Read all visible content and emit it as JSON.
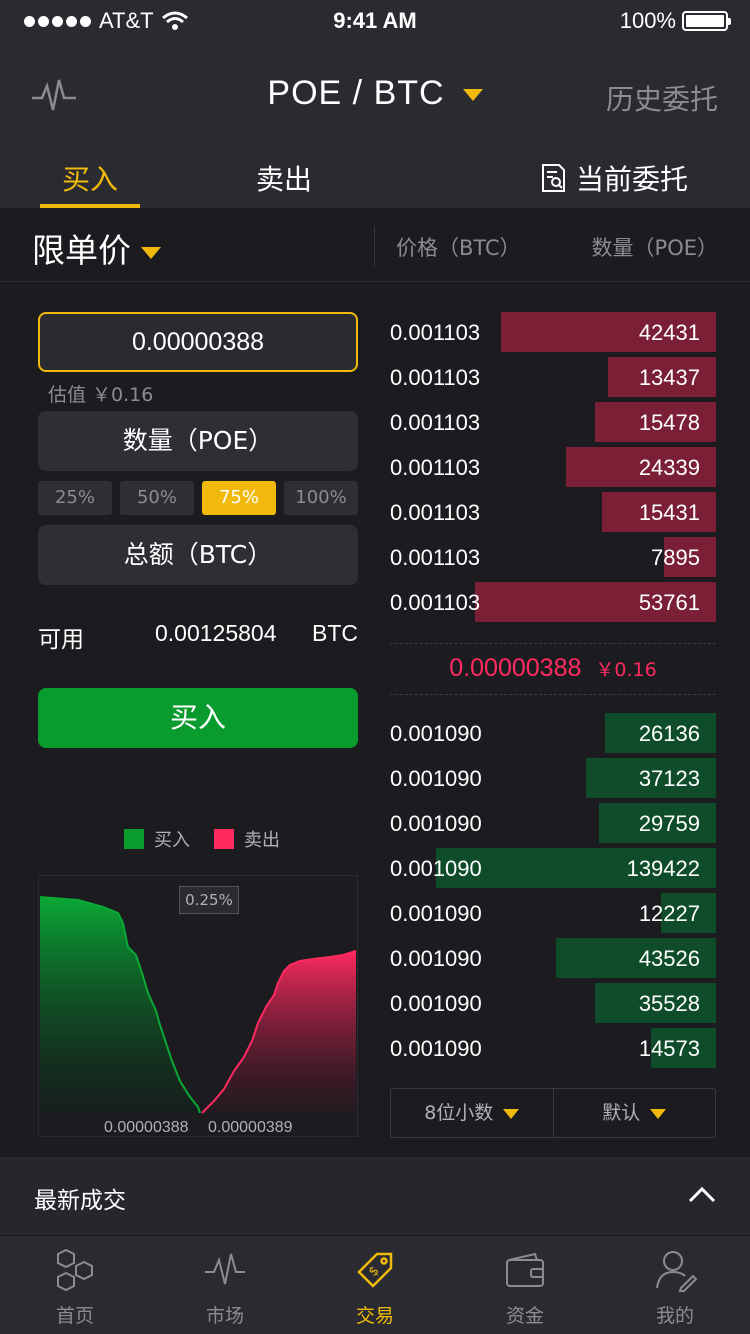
{
  "status": {
    "carrier": "AT&T",
    "time": "9:41 AM",
    "battery": "100%"
  },
  "header": {
    "pair": "POE / BTC",
    "history": "历史委托"
  },
  "tabs": {
    "buy": "买入",
    "sell": "卖出",
    "orders": "当前委托"
  },
  "order_type": {
    "label": "限单价",
    "price_header": "价格（BTC）",
    "qty_header": "数量（POE）"
  },
  "form": {
    "price": "0.00000388",
    "estimate": "估值  ￥0.16",
    "qty_placeholder": "数量（POE）",
    "percents": [
      "25%",
      "50%",
      "75%",
      "100%"
    ],
    "selected_percent": "75%",
    "total_placeholder": "总额（BTC）",
    "available_label": "可用",
    "available_value": "0.00125804",
    "available_currency": "BTC",
    "buy_button": "买入"
  },
  "depth_chart": {
    "legend_buy": "买入",
    "legend_sell": "卖出",
    "tip": "0.25%",
    "x_left": "0.00000388",
    "x_right": "0.00000389",
    "buy_color": "#0a9b2e",
    "sell_color": "#ff2a5f"
  },
  "asks": [
    {
      "price": "0.001103",
      "qty": "42431",
      "depth": 0.66
    },
    {
      "price": "0.001103",
      "qty": "13437",
      "depth": 0.33
    },
    {
      "price": "0.001103",
      "qty": "15478",
      "depth": 0.37
    },
    {
      "price": "0.001103",
      "qty": "24339",
      "depth": 0.46
    },
    {
      "price": "0.001103",
      "qty": "15431",
      "depth": 0.35
    },
    {
      "price": "0.001103",
      "qty": "7895",
      "depth": 0.16
    },
    {
      "price": "0.001103",
      "qty": "53761",
      "depth": 0.74
    }
  ],
  "mid_price": {
    "btc": "0.00000388",
    "cny": "￥0.16"
  },
  "bids": [
    {
      "price": "0.001090",
      "qty": "26136",
      "depth": 0.34
    },
    {
      "price": "0.001090",
      "qty": "37123",
      "depth": 0.4
    },
    {
      "price": "0.001090",
      "qty": "29759",
      "depth": 0.36
    },
    {
      "price": "0.001090",
      "qty": "139422",
      "depth": 0.86
    },
    {
      "price": "0.001090",
      "qty": "12227",
      "depth": 0.17
    },
    {
      "price": "0.001090",
      "qty": "43526",
      "depth": 0.49
    },
    {
      "price": "0.001090",
      "qty": "35528",
      "depth": 0.37
    },
    {
      "price": "0.001090",
      "qty": "14573",
      "depth": 0.2
    }
  ],
  "book_controls": {
    "decimals": "8位小数",
    "sort": "默认"
  },
  "latest": {
    "title": "最新成交"
  },
  "nav": {
    "home": "首页",
    "market": "市场",
    "trade": "交易",
    "funds": "资金",
    "mine": "我的"
  },
  "colors": {
    "accent": "#f0b90b",
    "ask_bar": "#7a1f36",
    "bid_bar": "#0f4d2a"
  }
}
